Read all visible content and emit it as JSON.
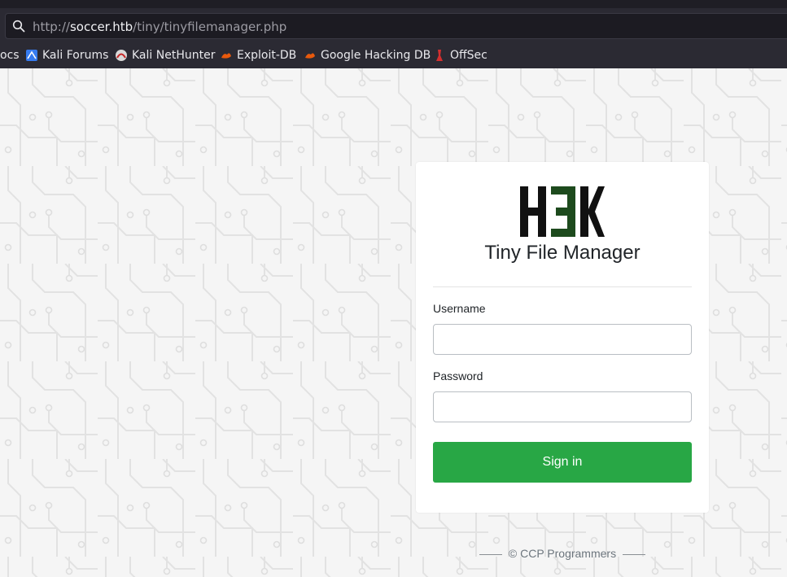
{
  "browser": {
    "url_prefix": "http://",
    "url_host": "soccer.htb",
    "url_path": "/tiny/tinyfilemanager.php",
    "bookmarks": [
      {
        "label": "ocs",
        "icon": "docs-icon"
      },
      {
        "label": "Kali Forums",
        "icon": "kali-forums-icon"
      },
      {
        "label": "Kali NetHunter",
        "icon": "nethunter-icon"
      },
      {
        "label": "Exploit-DB",
        "icon": "exploit-db-icon"
      },
      {
        "label": "Google Hacking DB",
        "icon": "ghdb-icon"
      },
      {
        "label": "OffSec",
        "icon": "offsec-icon"
      }
    ]
  },
  "login": {
    "title": "Tiny File Manager",
    "username_label": "Username",
    "username_value": "",
    "password_label": "Password",
    "password_value": "",
    "submit_label": "Sign in"
  },
  "footer": {
    "text": "© CCP Programmers"
  },
  "colors": {
    "accent": "#28a745",
    "chrome": "#2b2a33",
    "logo_green": "#1d4a1d"
  }
}
